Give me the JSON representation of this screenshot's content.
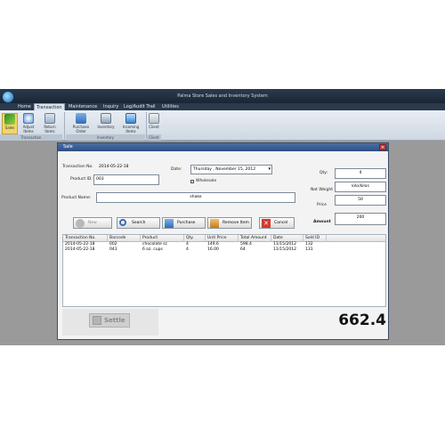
{
  "app": {
    "title": "Palma Store Sales and Inventory System"
  },
  "menu": {
    "tabs": [
      "Home",
      "Transaction",
      "Maintenance",
      "Inquiry",
      "Log/Audit Trail",
      "Utilities"
    ]
  },
  "ribbon": {
    "groups": [
      {
        "label": "Transaction",
        "buttons": [
          "Sales",
          "Adjust Items",
          "Return Items"
        ]
      },
      {
        "label": "Inventory",
        "buttons": [
          "Purchase Order",
          "Inventory",
          "Incoming Items"
        ]
      },
      {
        "label": "Client",
        "buttons": [
          "Client"
        ]
      }
    ]
  },
  "sale": {
    "window_title": "Sale",
    "transaction_no_label": "Transaction No.",
    "transaction_no": "2014-05-22-18",
    "product_id_label": "Product ID:",
    "product_id": "003",
    "date_label": "Date:",
    "date_value": "Thursday , November 15, 2012",
    "wholesale_label": "Wholesale",
    "product_name_label": "Product Name:",
    "product_name": "shake",
    "qty_label": "Qty:",
    "qty": "4",
    "unit": "kilo/kilos",
    "net_weight_label": "Net Weight",
    "price_label": "Price",
    "price": "50",
    "amount_label": "Amount",
    "amount": "200",
    "buttons": {
      "new": "New",
      "search": "Search",
      "purchase": "Purchase",
      "remove": "Remove Item",
      "cancel": "Cancel"
    },
    "table": {
      "columns": [
        "Transaction No.",
        "Barcode",
        "Product",
        "Qty.",
        "Unit Price",
        "Total Amount",
        "Date",
        "Sold ID"
      ],
      "rows": [
        [
          "2014-05-22-18",
          "002",
          "chocolate sc",
          "4",
          "149.6",
          "598.4",
          "11/15/2012",
          "132"
        ],
        [
          "2014-05-22-18",
          "043",
          "6 oz. cups",
          "4",
          "16.00",
          "64",
          "11/15/2012",
          "131"
        ]
      ]
    },
    "settle_label": "Settle",
    "total": "662.4"
  }
}
